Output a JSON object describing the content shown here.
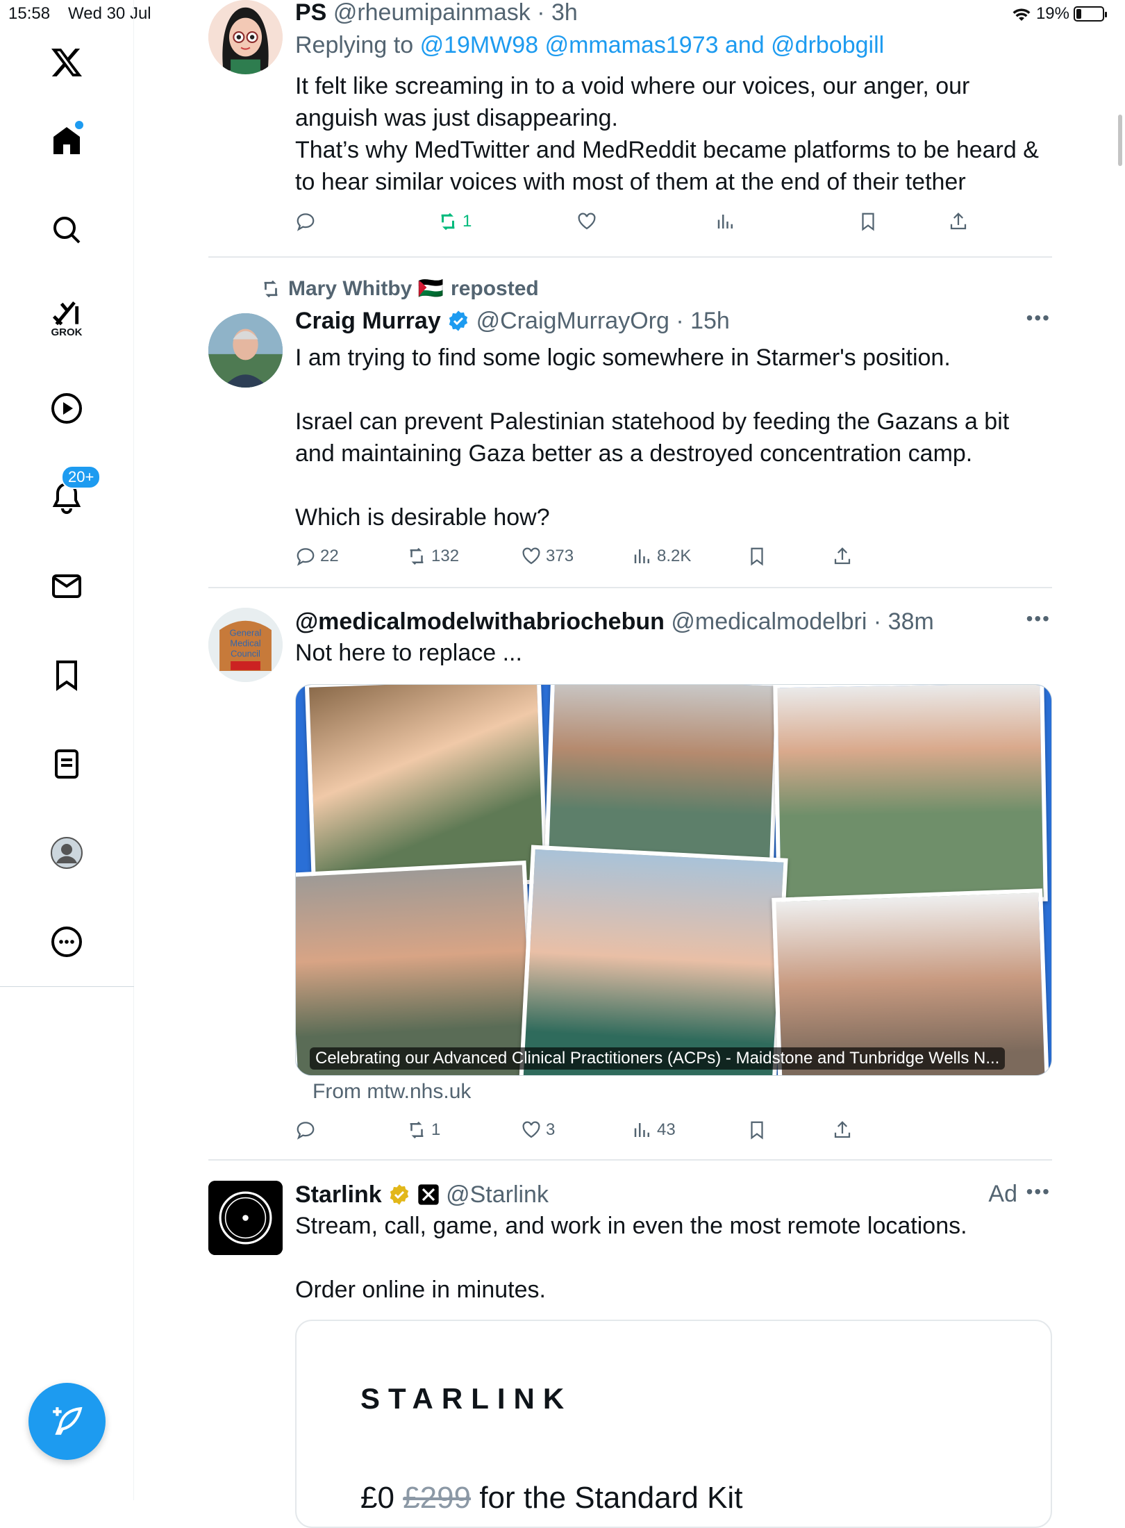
{
  "status_bar": {
    "time": "15:58",
    "date": "Wed 30 Jul",
    "battery": "19%",
    "battery_level": 0.19
  },
  "sidebar": {
    "home_label": "Home",
    "grok_label": "GROK",
    "notifications_badge": "20+"
  },
  "tweets": [
    {
      "name": "PS",
      "handle": "@rheumipainmask",
      "time": "3h",
      "reply_prefix": "Replying to",
      "reply_to": "@19MW98 @mmamas1973",
      "reply_and": "and",
      "reply_last": "@drbobgill",
      "lines": [
        "It felt like screaming in to a void where our voices, our anger, our",
        "anguish was just disappearing.",
        "That’s why MedTwitter and MedReddit became platforms to be heard &",
        "to hear similar voices with most of them at the end of their tether"
      ],
      "reposts": "1"
    },
    {
      "repost_by": "Mary Whitby 🇵🇸",
      "repost_word": "reposted",
      "name": "Craig Murray",
      "handle": "@CraigMurrayOrg",
      "time": "15h",
      "lines": [
        "I am trying to find some logic somewhere in Starmer's position.",
        "Israel can prevent Palestinian statehood by feeding the Gazans a bit",
        "and maintaining Gaza better as a destroyed concentration camp.",
        "Which is desirable how?"
      ],
      "replies": "22",
      "reposts": "132",
      "likes": "373",
      "views": "8.2K"
    },
    {
      "name": "@medicalmodelwithabriochebun",
      "handle": "@medicalmodelbri",
      "time": "38m",
      "text": "Not here to replace ...",
      "media_caption": "Celebrating our Advanced Clinical Practitioners (ACPs) - Maidstone and Tunbridge Wells N...",
      "from": "From mtw.nhs.uk",
      "replies": "",
      "reposts": "1",
      "likes": "3",
      "views": "43"
    },
    {
      "name": "Starlink",
      "handle": "@Starlink",
      "ad_label": "Ad",
      "line1": "Stream, call, game, and work in even the most remote locations.",
      "line2": "Order online in minutes.",
      "card_logo": "STARLINK",
      "card_price_now": "£0",
      "card_price_old": "£299",
      "card_price_rest": "for the Standard Kit"
    }
  ],
  "colors": {
    "accent": "#1d9bf0",
    "repost_green": "#00ba7c",
    "muted": "#536471"
  }
}
